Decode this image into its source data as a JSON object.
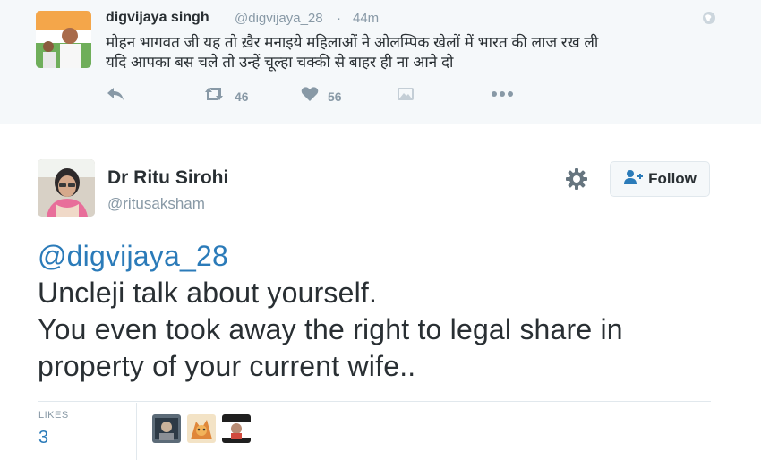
{
  "quoted_tweet": {
    "name": "digvijaya singh",
    "handle": "@digvijaya_28",
    "separator": "·",
    "time": "44m",
    "text_line1": "मोहन भागवत जी यह तो ख़ैर मनाइये महिलाओं ने ओलम्पिक खेलों में भारत की लाज रख ली",
    "text_line2": "यदि आपका बस चले तो उन्हें चूल्हा चक्की से बाहर ही ना आने दो",
    "retweets": "46",
    "likes": "56"
  },
  "tweet": {
    "name": "Dr Ritu Sirohi",
    "handle": "@ritusaksham",
    "follow_label": "Follow",
    "mention": "@digvijaya_28",
    "line1": "Uncleji talk about yourself.",
    "line2": "You even took away the right to legal share in",
    "line3": "property of your current wife.."
  },
  "stats": {
    "likes_label": "LIKES",
    "likes_count": "3"
  },
  "colors": {
    "link": "#2b7bb9",
    "muted": "#8899a6",
    "text": "#292f33",
    "quoted_bg": "#f5f8fa"
  },
  "icons": [
    "globe-icon",
    "reply-icon",
    "retweet-icon",
    "heart-icon",
    "media-icon",
    "more-icon",
    "gear-icon",
    "follow-person-icon"
  ]
}
